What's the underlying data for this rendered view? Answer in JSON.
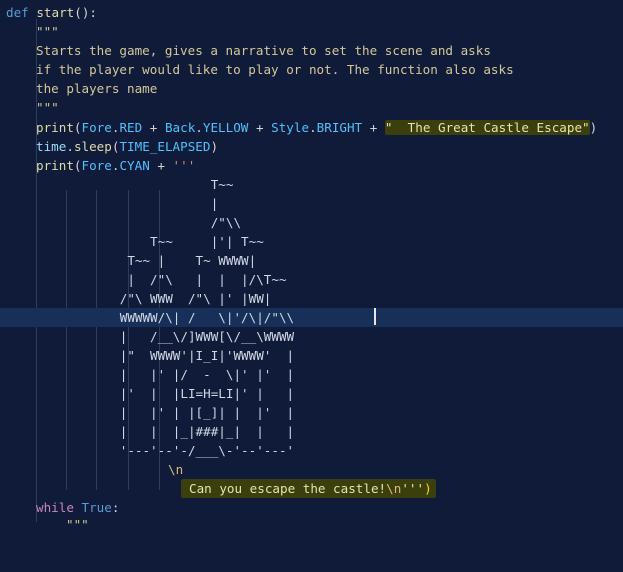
{
  "editor": {
    "language": "python",
    "lines": [
      {
        "text": "def start():",
        "kind": "def"
      },
      {
        "text": "    \"\"\"",
        "kind": "doc"
      },
      {
        "text": "    Starts the game, gives a narrative to set the scene and asks",
        "kind": "doc"
      },
      {
        "text": "    if the player would like to play or not. The function also asks",
        "kind": "doc"
      },
      {
        "text": "    the players name",
        "kind": "doc"
      },
      {
        "text": "    \"\"\"",
        "kind": "doc"
      },
      {
        "text": "    print(Fore.RED + Back.YELLOW + Style.BRIGHT + \"  The Great Castle Escape\")",
        "kind": "code"
      },
      {
        "text": "    time.sleep(TIME_ELAPSED)",
        "kind": "code"
      },
      {
        "text": "    print(Fore.CYAN + '''",
        "kind": "code"
      },
      {
        "text": "                            T~~",
        "kind": "art"
      },
      {
        "text": "                            |",
        "kind": "art"
      },
      {
        "text": "                           /\"\\\\",
        "kind": "art"
      },
      {
        "text": "                    T~~     |'| T~~",
        "kind": "art"
      },
      {
        "text": "                 T~~ |    T~ WWWW|",
        "kind": "art"
      },
      {
        "text": "                 |  /\"\\   |  |  |/\\T~~",
        "kind": "art"
      },
      {
        "text": "                /\"\\ WWW  /\"\\ |' |WW|",
        "kind": "art"
      },
      {
        "text": "                WWWWW/\\| /   \\|'/\\|/\"\\\\",
        "kind": "art"
      },
      {
        "text": "                |   /__\\/]WWW[\\/__\\WWWW",
        "kind": "art"
      },
      {
        "text": "                |\"  WWWW'|I_I|'WWWW'  |",
        "kind": "art"
      },
      {
        "text": "                |   |' |/  -  \\|' |'  |",
        "kind": "art"
      },
      {
        "text": "                |'  |  |LI=H=LI|' |   |",
        "kind": "art"
      },
      {
        "text": "                |   |' | |[_]| |  |'  |",
        "kind": "art"
      },
      {
        "text": "                |   |  |_|###|_|  |   |",
        "kind": "art"
      },
      {
        "text": "                '---'--'-/___\\-'--'---'",
        "kind": "art"
      },
      {
        "text": "             \\n",
        "kind": "art"
      },
      {
        "text": "               Can you escape the castle!\\n''')",
        "kind": "art"
      },
      {
        "text": "    while True:",
        "kind": "while"
      },
      {
        "text": "        \"\"\"",
        "kind": "doc"
      }
    ]
  },
  "tokens": {
    "def": "def",
    "start": "start",
    "parens_colon": "():",
    "doc_quotes": "\"\"\"",
    "doc1": "Starts the game, gives a narrative to set the scene and asks",
    "doc2": "if the player would like to play or not. The function also asks",
    "doc3": "the players name",
    "print": "print",
    "open": "(",
    "close": ")",
    "fore": "Fore",
    "red": "RED",
    "back": "Back",
    "yellow": "YELLOW",
    "style": "Style",
    "bright": "BRIGHT",
    "dot": ".",
    "plus": " + ",
    "title_str": "\"  The Great Castle Escape\"",
    "time": "time",
    "sleep": "sleep",
    "time_elapsed": "TIME_ELAPSED",
    "cyan": "CYAN",
    "triple_single": "'''",
    "art": [
      "                           T~~",
      "                           |",
      "                           /\"\\\\",
      "                   T~~     |'| T~~",
      "                T~~ |    T~ WWWW|",
      "                |  /\"\\   |  |  |/\\T~~",
      "               /\"\\ WWW  /\"\\ |' |WW|",
      "               WWWWW/\\| /   \\|'/\\|/\"\\\\",
      "               |   /__\\/]WWW[\\/__\\WWWW",
      "               |\"  WWWW'|I_I|'WWWW'  |",
      "               |   |' |/  -  \\|' |'  |",
      "               |'  |  |LI=H=LI|' |   |",
      "               |   |' | |[_]| |  |'  |",
      "               |   |  |_|###|_|  |   |",
      "               '---'--'-/___\\-'--'---'"
    ],
    "newline_escape": "\\n",
    "escape_text": "Can you escape the castle!",
    "end_quote": "'''",
    "while": "while",
    "true": "True",
    "colon": ":"
  },
  "colors": {
    "background": "#0f1b38",
    "keyword": "#569cd6",
    "control": "#c586c0",
    "function": "#dcdcaa",
    "string": "#ce9178",
    "highlight": "#3a3f0d"
  }
}
